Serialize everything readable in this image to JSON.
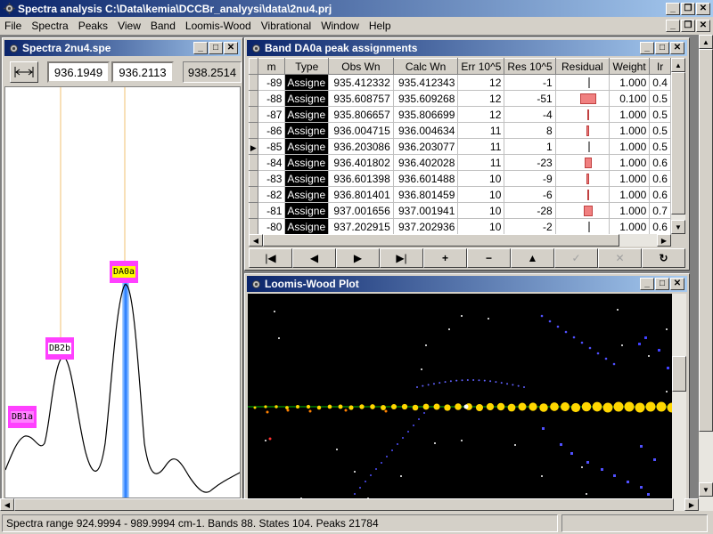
{
  "app": {
    "title": "Spectra analysis C:\\Data\\kemia\\DCCBr_analyysi\\data\\2nu4.prj",
    "menu": [
      "File",
      "Spectra",
      "Peaks",
      "View",
      "Band",
      "Loomis-Wood",
      "Vibrational",
      "Window",
      "Help"
    ]
  },
  "spectra_window": {
    "title": "Spectra 2nu4.spe",
    "range_left": "936.1949",
    "range_right": "936.2113",
    "cursor": "938.2514",
    "labels": [
      "DB1a",
      "DB2b",
      "DA0a"
    ]
  },
  "band_window": {
    "title": "Band DA0a peak assignments",
    "columns": [
      "m",
      "Type",
      "Obs Wn",
      "Calc Wn",
      "Err 10^5",
      "Res 10^5",
      "Residual",
      "Weight",
      "Ir"
    ],
    "rows": [
      {
        "m": "-89",
        "type": "Assigne",
        "obs": "935.412332",
        "calc": "935.412343",
        "err": "12",
        "res": "-1",
        "weight": "1.000",
        "ir": "0.4",
        "bar": 0
      },
      {
        "m": "-88",
        "type": "Assigne",
        "obs": "935.608757",
        "calc": "935.609268",
        "err": "12",
        "res": "-51",
        "weight": "0.100",
        "ir": "0.5",
        "bar": 51
      },
      {
        "m": "-87",
        "type": "Assigne",
        "obs": "935.806657",
        "calc": "935.806699",
        "err": "12",
        "res": "-4",
        "weight": "1.000",
        "ir": "0.5",
        "bar": 4
      },
      {
        "m": "-86",
        "type": "Assigne",
        "obs": "936.004715",
        "calc": "936.004634",
        "err": "11",
        "res": "8",
        "weight": "1.000",
        "ir": "0.5",
        "bar": 8
      },
      {
        "m": "-85",
        "type": "Assigne",
        "obs": "936.203086",
        "calc": "936.203077",
        "err": "11",
        "res": "1",
        "weight": "1.000",
        "ir": "0.5",
        "bar": 1,
        "current": true
      },
      {
        "m": "-84",
        "type": "Assigne",
        "obs": "936.401802",
        "calc": "936.402028",
        "err": "11",
        "res": "-23",
        "weight": "1.000",
        "ir": "0.6",
        "bar": 23
      },
      {
        "m": "-83",
        "type": "Assigne",
        "obs": "936.601398",
        "calc": "936.601488",
        "err": "10",
        "res": "-9",
        "weight": "1.000",
        "ir": "0.6",
        "bar": 9
      },
      {
        "m": "-82",
        "type": "Assigne",
        "obs": "936.801401",
        "calc": "936.801459",
        "err": "10",
        "res": "-6",
        "weight": "1.000",
        "ir": "0.6",
        "bar": 6
      },
      {
        "m": "-81",
        "type": "Assigne",
        "obs": "937.001656",
        "calc": "937.001941",
        "err": "10",
        "res": "-28",
        "weight": "1.000",
        "ir": "0.7",
        "bar": 28
      },
      {
        "m": "-80",
        "type": "Assigne",
        "obs": "937.202915",
        "calc": "937.202936",
        "err": "10",
        "res": "-2",
        "weight": "1.000",
        "ir": "0.6",
        "bar": 2
      }
    ],
    "nav": [
      "|◀",
      "◀",
      "▶",
      "▶|",
      "+",
      "−",
      "▲",
      "✓",
      "✕",
      "↻"
    ]
  },
  "lw_window": {
    "title": "Loomis-Wood Plot"
  },
  "status": {
    "text": "Spectra range 924.9994 - 989.9994 cm-1. Bands 88. States 104. Peaks 21784"
  },
  "colors": {
    "title_start": "#0a246a",
    "title_end": "#a6caf0",
    "residual_bar": "#f08080",
    "peak_label_bg": "#ff40ff",
    "peak_label_yellow": "#ffff00",
    "selected_peak": "#1e78ff",
    "lw_main_series": "#ffd700"
  }
}
